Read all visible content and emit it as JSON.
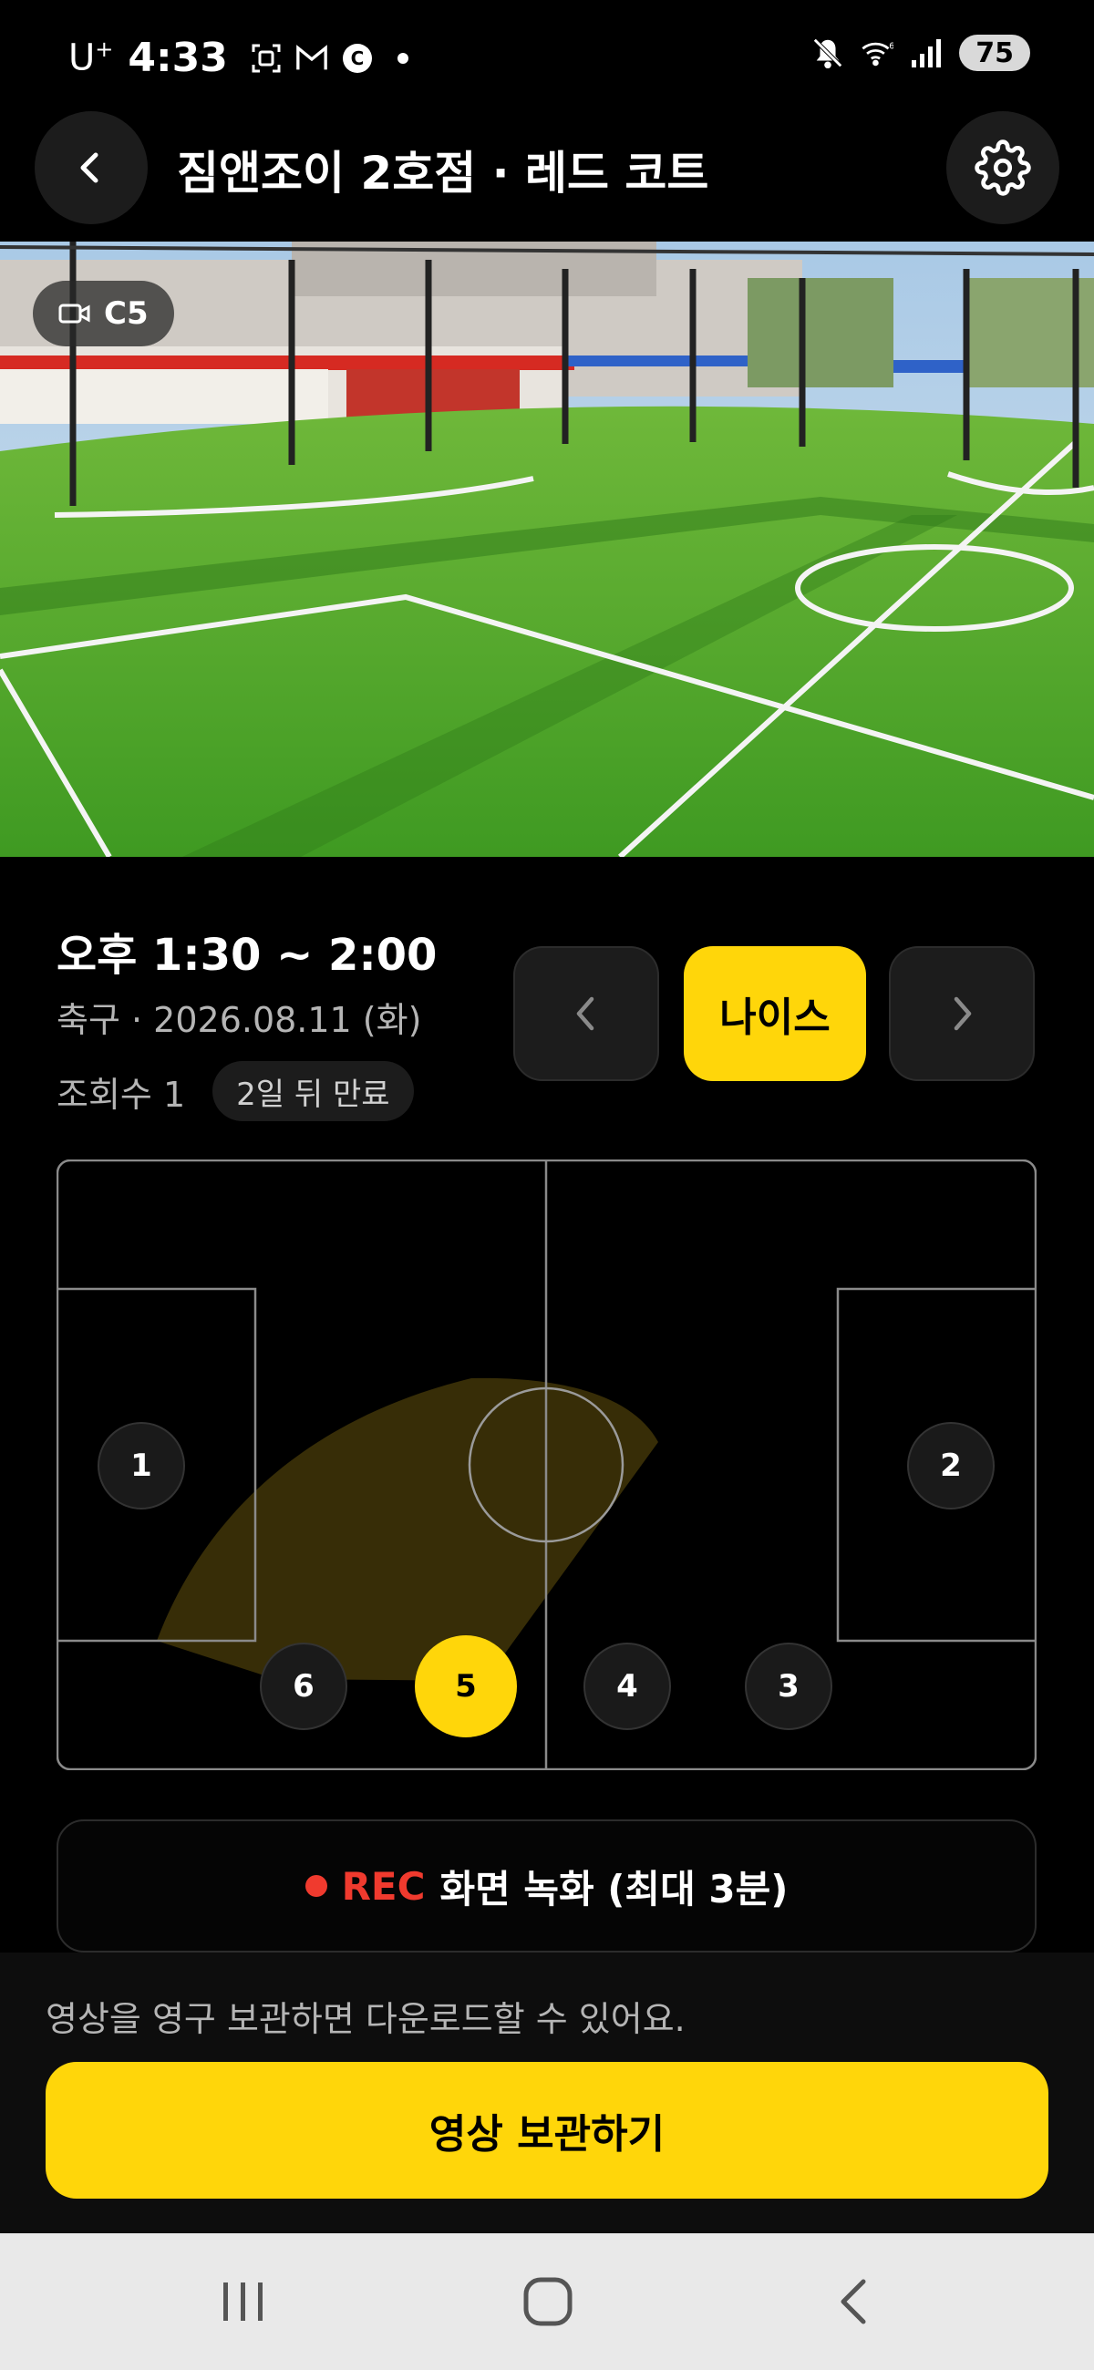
{
  "status_bar": {
    "time": "4:33",
    "carrier": "U",
    "carrier_sup": "+",
    "battery": "75",
    "left_icons": [
      "screenshot-icon",
      "gmail-icon",
      "c-app-icon",
      "notification-dot-icon"
    ],
    "right_icons": [
      "mute-icon",
      "wifi-icon",
      "signal-icon"
    ]
  },
  "header": {
    "title": "짐앤조이 2호점 · 레드 코트",
    "back_icon": "chevron-left-icon",
    "settings_icon": "gear-icon"
  },
  "camera": {
    "label": "C5",
    "label_icon": "video-camera-icon"
  },
  "session": {
    "time_range": "오후 1:30 ~ 2:00",
    "meta": "축구 · 2026.08.11 (화)",
    "views": "조회수 1",
    "expiry_badge": "2일 뒤 만료"
  },
  "highlight_nav": {
    "prev_icon": "chevron-left-icon",
    "current_label": "나이스",
    "next_icon": "chevron-right-icon"
  },
  "field": {
    "cameras": [
      "1",
      "2",
      "6",
      "5",
      "4",
      "3"
    ],
    "active_camera": "5",
    "colors": {
      "line": "#8a8a8a",
      "coverage": "#3d3208",
      "active": "#ffd60a"
    }
  },
  "record": {
    "rec_label": "REC",
    "text": "화면 녹화 (최대 3분)"
  },
  "footer": {
    "note": "영상을 영구 보관하면 다운로드할 수 있어요.",
    "save_button": "영상 보관하기"
  },
  "system_nav": {
    "recents_icon": "recents-icon",
    "home_icon": "home-icon",
    "back_icon": "back-icon"
  },
  "colors": {
    "accent": "#ffd60a",
    "rec": "#f03a2e",
    "background": "#000000",
    "surface": "#1c1c1c"
  }
}
